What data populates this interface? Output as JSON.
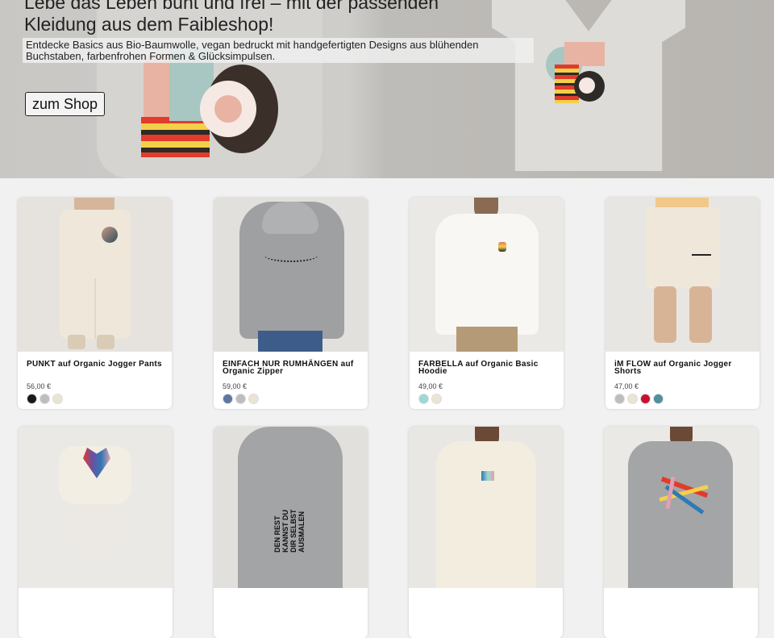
{
  "hero": {
    "title": "Lebe das Leben bunt und frei – mit der passenden Kleidung aus dem Faibleshop!",
    "subtitle": "Entdecke Basics aus Bio-Baumwolle, vegan bedruckt mit handgefertigten Designs aus blühenden Buchstaben, farbenfrohen Formen & Glücksimpulsen.",
    "button_label": "zum Shop"
  },
  "products": [
    {
      "title": "PUNKT auf Organic Jogger Pants",
      "price": "56,00 €",
      "swatches": [
        "#1a1a1a",
        "#bdbdbd",
        "#ebe4d3"
      ]
    },
    {
      "title": "EINFACH NUR RUMHÄNGEN auf Organic Zipper",
      "price": "59,00 €",
      "swatches": [
        "#5c77a0",
        "#bdbdbd",
        "#ebe4d3"
      ]
    },
    {
      "title": "FARBELLA auf Organic Basic Hoodie",
      "price": "49,00 €",
      "swatches": [
        "#9ed8d2",
        "#ebe4d3"
      ]
    },
    {
      "title": "iM FLOW auf Organic Jogger Shorts",
      "price": "47,00 €",
      "swatches": [
        "#bdbdbd",
        "#ebe4d3",
        "#c8102e",
        "#4f8fa0"
      ]
    }
  ],
  "row2_print_text": "DEN REST KANNST DU DIR SELBST AUSMALEN"
}
